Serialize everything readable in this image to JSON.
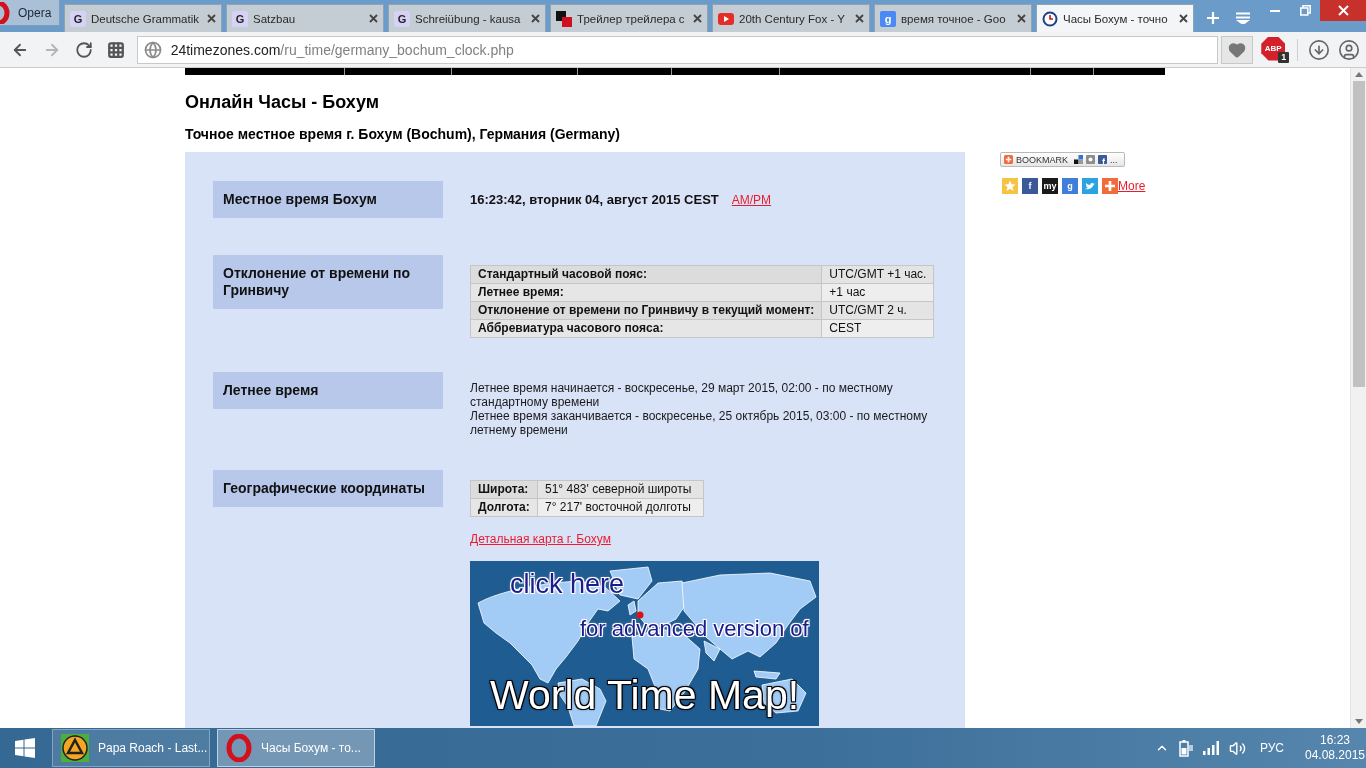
{
  "browser": {
    "menu_label": "Opera",
    "tabs": [
      {
        "title": "Deutsche Grammatik",
        "selected": false,
        "favicon": {
          "kind": "letter",
          "text": "G",
          "color": "#d6d2f6"
        }
      },
      {
        "title": "Satzbau",
        "selected": false,
        "favicon": {
          "kind": "letter",
          "text": "G",
          "color": "#d6d2f6"
        }
      },
      {
        "title": "Schreiübung - kausa",
        "selected": false,
        "favicon": {
          "kind": "letter",
          "text": "G",
          "color": "#d6d2f6"
        }
      },
      {
        "title": "Трейлер трейлера с",
        "selected": false,
        "favicon": {
          "kind": "squares"
        }
      },
      {
        "title": "20th Century Fox - Y",
        "selected": false,
        "favicon": {
          "kind": "video"
        }
      },
      {
        "title": "время точное - Goo",
        "selected": false,
        "favicon": {
          "kind": "letter",
          "text": "g",
          "color": "#4a8af4"
        }
      },
      {
        "title": "Часы Бохум - точно",
        "selected": true,
        "favicon": {
          "kind": "clock"
        }
      }
    ],
    "nav_buttons": [
      {
        "kind": "back",
        "disabled": false
      },
      {
        "kind": "forward",
        "disabled": true
      },
      {
        "kind": "reload",
        "disabled": false
      },
      {
        "kind": "speed_dial",
        "disabled": false
      }
    ],
    "address": {
      "domain": "24timezones.com",
      "path": "/ru_time/germany_bochum_clock.php"
    },
    "adblock": {
      "label": "ABP",
      "count": "1"
    }
  },
  "page": {
    "title": "Онлайн Часы - Бохум",
    "subtitle": "Точное местное время г. Бохум (Bochum), Германия (Germany)",
    "sections": [
      {
        "kind": "time",
        "label": "Местное время Бохум",
        "value": "16:23:42, вторник 04, август 2015 CEST",
        "link": "AM/PM"
      },
      {
        "kind": "table",
        "label": "Отклонение от времени по Гринвичу",
        "rows": [
          [
            "Стандартный часовой пояс:",
            "UTC/GMT +1 час."
          ],
          [
            "Летнее время:",
            "+1 час"
          ],
          [
            "Отклонение от времени по Гринвичу в текущий момент:",
            "UTC/GMT 2 ч."
          ],
          [
            "Аббревиатура часового пояса:",
            "CEST"
          ]
        ]
      },
      {
        "kind": "text",
        "label": "Летнее время",
        "lines": [
          "Летнее время начинается - воскресенье, 29 март 2015, 02:00 - по местному стандартному времени",
          "Летнее время заканчивается - воскресенье, 25 октябрь 2015, 03:00 - по местному летнему времени"
        ]
      },
      {
        "kind": "coords",
        "label": "Географические координаты",
        "rows": [
          [
            "Широта:",
            "51° 483' северной широты"
          ],
          [
            "Долгота:",
            "7° 217' восточной долготы"
          ]
        ],
        "link": "Детальная карта г. Бохум",
        "map": {
          "line_1": "click here",
          "line_2": "for advanced version of",
          "line_3": "World Time Map!"
        }
      }
    ]
  },
  "sidebar": {
    "bookmark_label": "BOOKMARK",
    "bookmark_suffix": "...",
    "share": [
      {
        "kind": "star",
        "color": "#f6c343"
      },
      {
        "kind": "letter",
        "text": "f",
        "color": "#3b5998"
      },
      {
        "kind": "letter",
        "text": "my",
        "color": "#1a1a1a"
      },
      {
        "kind": "letter",
        "text": "g",
        "color": "#3f7fd9"
      },
      {
        "kind": "bird",
        "color": "#2aa3e0"
      },
      {
        "kind": "plus",
        "color": "#f26b3a"
      }
    ],
    "more_link": "More"
  },
  "taskbar": {
    "items": [
      {
        "kind": "player",
        "title": "Papa Roach - Last...",
        "selected": false
      },
      {
        "kind": "browser",
        "title": "Часы Бохум - то...",
        "selected": true
      }
    ],
    "language": "РУС",
    "time": "16:23",
    "date": "04.08.2015"
  }
}
